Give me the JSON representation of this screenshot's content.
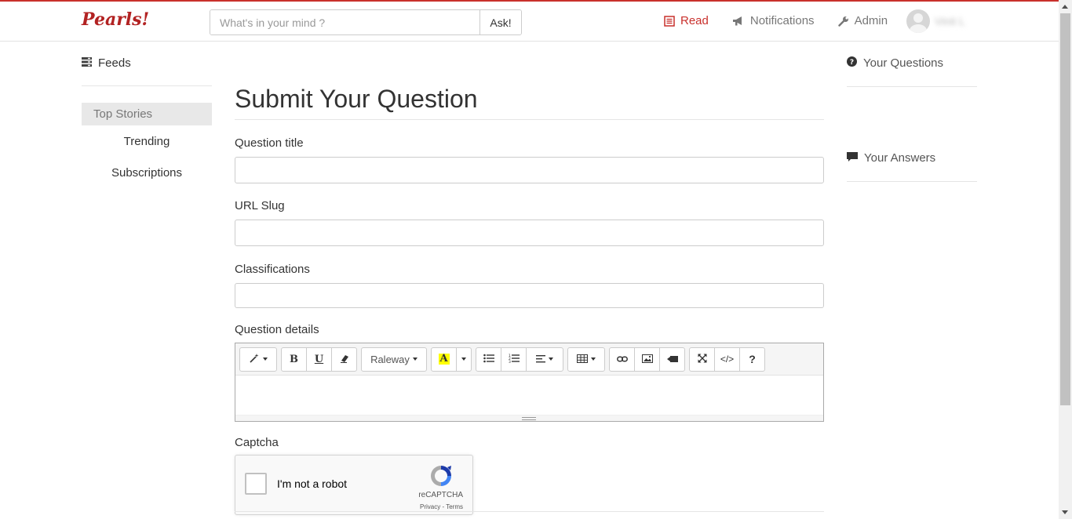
{
  "header": {
    "brand": "Pearls!",
    "search": {
      "placeholder": "What's in your mind ?",
      "button": "Ask!"
    },
    "nav": [
      {
        "label": "Read",
        "icon": "list-alt-icon",
        "active": true
      },
      {
        "label": "Notifications",
        "icon": "bullhorn-icon",
        "active": false
      },
      {
        "label": "Admin",
        "icon": "wrench-icon",
        "active": false
      }
    ],
    "user": {
      "icon": "avatar-icon",
      "name": "Vinit L"
    }
  },
  "left_sidebar": {
    "feeds_label": "Feeds",
    "items": [
      {
        "label": "Top Stories",
        "active": true
      },
      {
        "label": "Trending"
      },
      {
        "label": "Subscriptions"
      }
    ]
  },
  "right_sidebar": {
    "items": [
      {
        "label": "Your Questions",
        "icon": "question-circle-icon"
      },
      {
        "label": "Your Answers",
        "icon": "comment-icon"
      }
    ]
  },
  "form": {
    "title": "Submit Your Question",
    "fields": {
      "question_title": {
        "label": "Question title",
        "value": ""
      },
      "url_slug": {
        "label": "URL Slug",
        "value": ""
      },
      "classifications": {
        "label": "Classifications",
        "value": ""
      }
    },
    "details_label": "Question details",
    "toolbar": {
      "font_name": "Raleway",
      "bold": "B",
      "underline": "U",
      "help": "?",
      "codeview": "</>"
    },
    "captcha": {
      "label": "Captcha",
      "checkbox_text": "I'm not a robot",
      "brand": "reCAPTCHA",
      "terms": "Privacy - Terms"
    }
  },
  "colors": {
    "accent": "#c9302c",
    "brand": "#b22222"
  }
}
